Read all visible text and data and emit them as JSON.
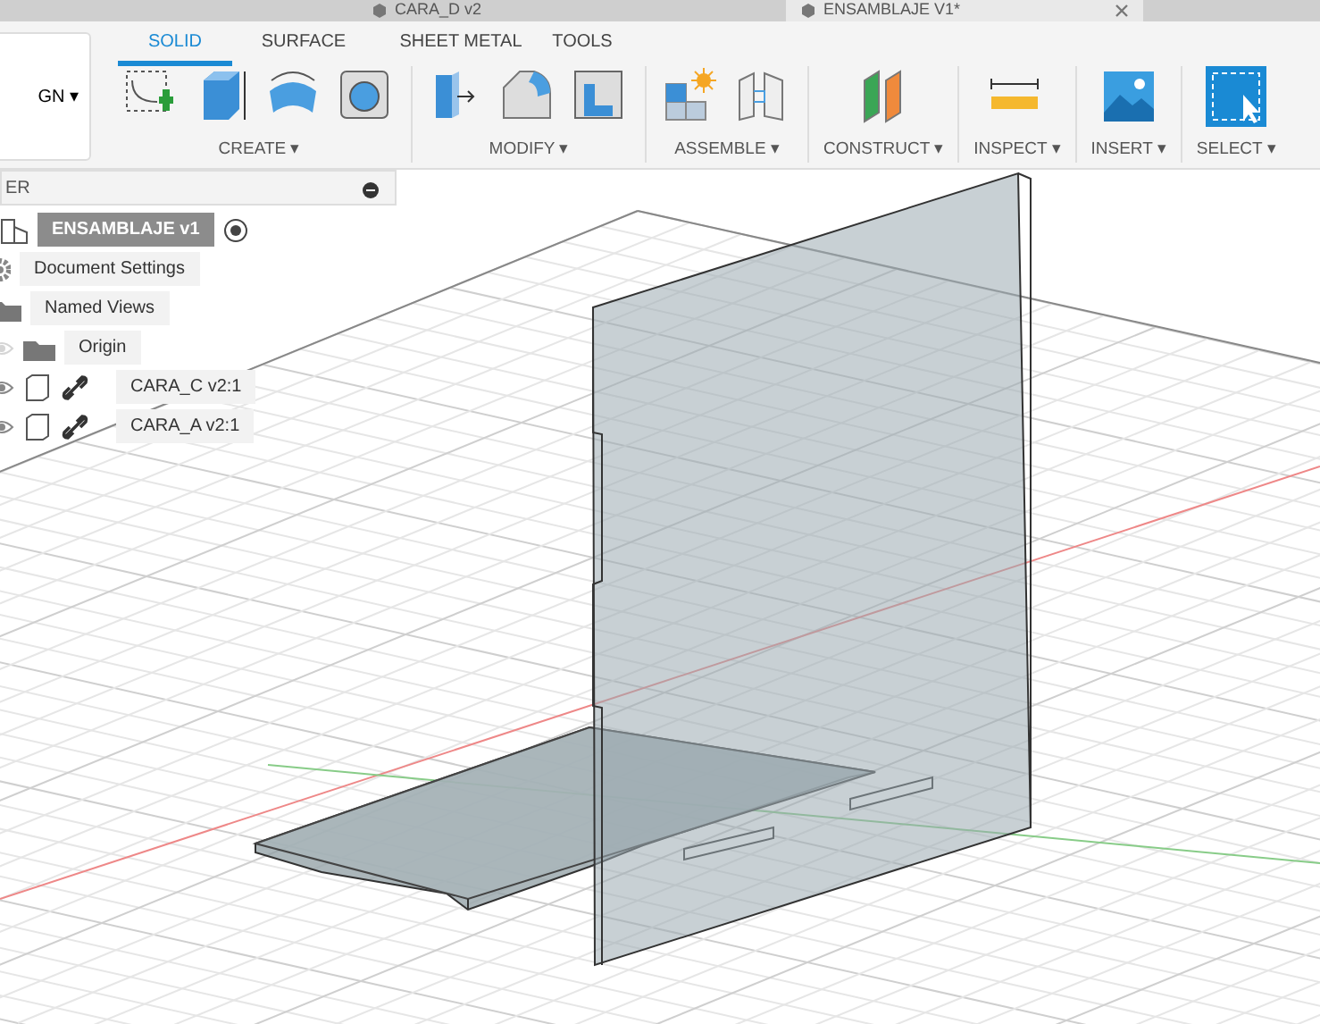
{
  "doc_tabs": [
    {
      "title": "CARA_D v2",
      "selected": false
    },
    {
      "title": "ENSAMBLAJE V1*",
      "selected": true
    }
  ],
  "workspace_button": {
    "label": "GN ▾"
  },
  "toolbar_tabs": [
    {
      "label": "SOLID",
      "selected": true
    },
    {
      "label": "SURFACE",
      "selected": false
    },
    {
      "label": "SHEET METAL",
      "selected": false
    },
    {
      "label": "TOOLS",
      "selected": false
    }
  ],
  "tool_groups": [
    {
      "label": "CREATE ▾",
      "tools": [
        {
          "kind": "sketch"
        },
        {
          "kind": "extrude"
        },
        {
          "kind": "revolve"
        },
        {
          "kind": "hole"
        }
      ]
    },
    {
      "label": "MODIFY ▾",
      "tools": [
        {
          "kind": "presspull"
        },
        {
          "kind": "fillet"
        },
        {
          "kind": "shell"
        }
      ]
    },
    {
      "label": "ASSEMBLE ▾",
      "tools": [
        {
          "kind": "component"
        },
        {
          "kind": "joint"
        }
      ]
    },
    {
      "label": "CONSTRUCT ▾",
      "tools": [
        {
          "kind": "plane"
        }
      ]
    },
    {
      "label": "INSPECT ▾",
      "tools": [
        {
          "kind": "measure"
        }
      ]
    },
    {
      "label": "INSERT ▾",
      "tools": [
        {
          "kind": "image"
        }
      ]
    },
    {
      "label": "SELECT ▾",
      "tools": [
        {
          "kind": "select"
        }
      ]
    }
  ],
  "browser": {
    "title": "ER",
    "root": {
      "label": "ENSAMBLAJE v1",
      "children": [
        {
          "label": "Document Settings",
          "kind": "settings"
        },
        {
          "label": "Named Views",
          "kind": "folder"
        },
        {
          "label": "Origin",
          "kind": "folder",
          "visible": false
        },
        {
          "label": "CARA_C v2:1",
          "kind": "component",
          "visible": true
        },
        {
          "label": "CARA_A v2:1",
          "kind": "component",
          "visible": true
        }
      ]
    }
  }
}
